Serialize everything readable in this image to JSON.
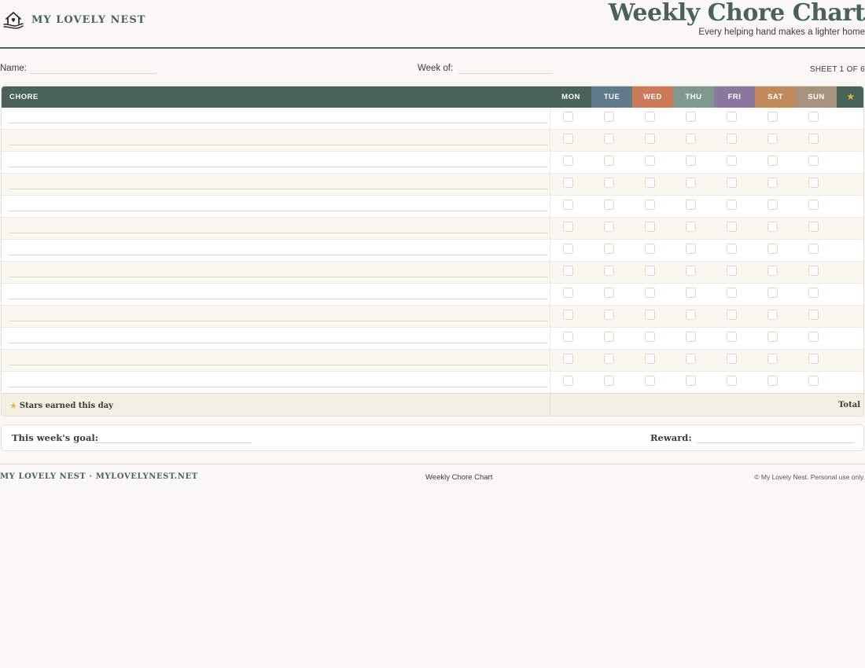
{
  "brand": {
    "name": "MY LOVELY NEST",
    "logo_icon": "house-heart-hand-icon"
  },
  "header": {
    "title": "Weekly Chore Chart",
    "subtitle": "Every helping hand makes a lighter home"
  },
  "meta": {
    "name_label": "Name:",
    "week_label": "Week of:",
    "sheet": "SHEET 1 OF 6"
  },
  "table": {
    "chore_header": "CHORE",
    "days": [
      {
        "label": "MON",
        "color": "#4a6358"
      },
      {
        "label": "TUE",
        "color": "#5f7a8a"
      },
      {
        "label": "WED",
        "color": "#cd7a5a"
      },
      {
        "label": "THU",
        "color": "#7f9a8c"
      },
      {
        "label": "FRI",
        "color": "#8b789e"
      },
      {
        "label": "SAT",
        "color": "#c08a5a"
      },
      {
        "label": "SUN",
        "color": "#a8937d"
      }
    ],
    "star_header": "★",
    "row_count": 13,
    "footer_label": "Stars earned this day",
    "footer_star": "★",
    "total_label": "Total"
  },
  "goal": {
    "goal_label": "This week's goal:",
    "reward_label": "Reward:"
  },
  "footer": {
    "left": "MY LOVELY NEST · MYLOVELYNEST.NET",
    "center": "Weekly Chore Chart",
    "right": "© My Lovely Nest. Personal use only."
  },
  "colors": {
    "primary": "#4a6358",
    "star": "#e0b84a",
    "row_alt": "#faf7f1"
  }
}
